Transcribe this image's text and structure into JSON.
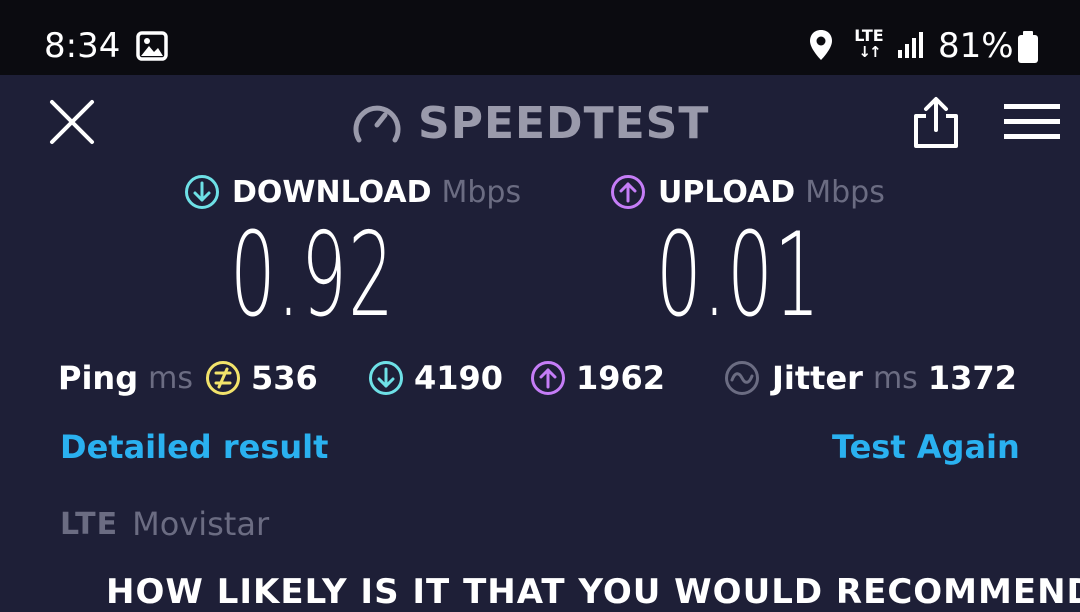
{
  "status_bar": {
    "time": "8:34",
    "network": "LTE",
    "network_arrows": "↓↑",
    "battery_percent": "81%",
    "icons": [
      "gallery-icon",
      "location-icon",
      "lte-icon",
      "signal-icon",
      "battery-icon"
    ]
  },
  "header": {
    "title": "SPEEDTEST",
    "icons": [
      "close-icon",
      "speedometer-icon",
      "share-icon",
      "menu-icon"
    ]
  },
  "results": {
    "download": {
      "label": "DOWNLOAD",
      "unit": "Mbps",
      "value": "0.92"
    },
    "upload": {
      "label": "UPLOAD",
      "unit": "Mbps",
      "value": "0.01"
    }
  },
  "stats": {
    "ping": {
      "label": "Ping",
      "unit": "ms",
      "value": "536"
    },
    "download_latency": {
      "value": "4190"
    },
    "upload_latency": {
      "value": "1962"
    },
    "jitter": {
      "label": "Jitter",
      "unit": "ms",
      "value": "1372"
    }
  },
  "links": {
    "detailed": "Detailed result",
    "again": "Test Again"
  },
  "provider": {
    "network": "LTE",
    "name": "Movistar"
  },
  "cutoff_text": "HOW LIKELY IS IT THAT YOU WOULD RECOMMEND",
  "colors": {
    "background": "#1e1f37",
    "status_bar": "#0b0b10",
    "download_accent": "#6ee0e6",
    "upload_accent": "#c57df7",
    "ping_accent": "#f2e36b",
    "link": "#2ab1f0",
    "muted": "#6b6c82"
  }
}
